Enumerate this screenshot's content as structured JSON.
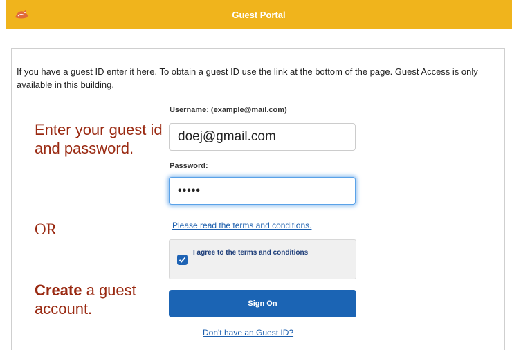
{
  "header": {
    "title": "Guest Portal",
    "logo_icon": "bird-logo-icon",
    "background": "#f0b41c"
  },
  "intro": "If you have a guest ID enter it here. To obtain a guest ID use the link at the bottom of the page.  Guest Access is only available in this building.",
  "annotations": {
    "top": "Enter your guest id and password.",
    "or": "OR",
    "bottom_bold": "Create",
    "bottom_rest": " a guest account.",
    "color": "#9a2a12"
  },
  "form": {
    "username_label": "Username: (example@mail.com)",
    "username_value": "doej@gmail.com",
    "password_label": "Password:",
    "password_value": "•••••",
    "terms_link": "Please read the terms and conditions.",
    "agree_label": "I agree to the terms and conditions",
    "agree_checked": true,
    "signon_label": "Sign On",
    "no_id_link": "Don't have an Guest ID?"
  },
  "colors": {
    "primary_button": "#1b64b4",
    "link": "#1c5fae",
    "focus_glow": "#5aa2e8"
  }
}
